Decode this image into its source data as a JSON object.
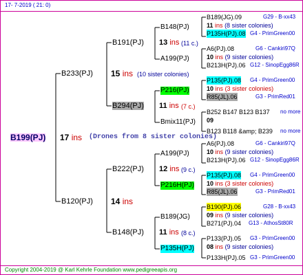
{
  "header": {
    "date": "17-  7-2019 (  21:  0)"
  },
  "footer": {
    "copyright": "Copyright 2004-2019 @ Karl Kehrle Foundation    www.pedigreeapis.org"
  },
  "tree": {
    "root": {
      "name": "B199(PJ)",
      "ins_count": "17",
      "ins_word": "ins",
      "note": "(Drones from 8 sister colonies)"
    },
    "gen1": [
      {
        "name": "B233(PJ)",
        "ins_count": "15",
        "ins_word": "ins",
        "note": "(10 sister colonies)"
      },
      {
        "name": "B120(PJ)",
        "ins_count": "14",
        "ins_word": "ins"
      }
    ],
    "gen2": [
      {
        "name": "B191(PJ)",
        "ins_count": "13",
        "ins_word": "ins",
        "note": "(11 c.)"
      },
      {
        "name": "B294(PJ)",
        "ins_count": "11",
        "ins_word": "ins",
        "note": "(7 c.)"
      },
      {
        "name": "B222(PJ)",
        "ins_count": "12",
        "ins_word": "ins",
        "note": "(9 c.)"
      },
      {
        "name": "B148(PJ)",
        "ins_count": "11",
        "ins_word": "ins",
        "note": "(8 c.)"
      }
    ],
    "gen3": [
      {
        "name": "B148(PJ)"
      },
      {
        "name": "A199(PJ)"
      },
      {
        "name": "P216(PJ)"
      },
      {
        "name": "Bmix11(PJ)"
      },
      {
        "name": "A199(PJ)"
      },
      {
        "name": "P216H(PJ)"
      },
      {
        "name": "B189(JG)"
      },
      {
        "name": "P135H(PJ)"
      }
    ],
    "gen4": [
      {
        "line1": "B189(JG).09",
        "code1": "G29 - B-xx43",
        "count": "11",
        "ins_word": "ins",
        "note": "(8 sister colonies)",
        "line3": "P135H(PJ).08",
        "code3": "G4 - PrimGreen00"
      },
      {
        "line1": "A6(PJ).08",
        "code1": "G6 - Cankiri97Q",
        "count": "10",
        "ins_word": "ins",
        "note": "(9 sister colonies)",
        "line3": "B213H(PJ).06",
        "code3": "G12 - SinopEgg86R"
      },
      {
        "line1": "P135(PJ).08",
        "code1": "G4 - PrimGreen00",
        "count": "10",
        "ins_word": "ins",
        "note": "(3 sister colonies)",
        "line3": "R85(JL).06",
        "code3": "G3 - PrimRed01"
      },
      {
        "line1": "B252 B147 B123 B137",
        "code1": "no more",
        "count": "09",
        "ins_word": "",
        "note": "",
        "line3": "B123 B118 &amp; B239",
        "code3": "no more"
      },
      {
        "line1": "A6(PJ).08",
        "code1": "G6 - Cankiri97Q",
        "count": "10",
        "ins_word": "ins",
        "note": "(9 sister colonies)",
        "line3": "B213H(PJ).06",
        "code3": "G12 - SinopEgg86R"
      },
      {
        "line1": "P135(PJ).08",
        "code1": "G4 - PrimGreen00",
        "count": "10",
        "ins_word": "ins",
        "note": "(3 sister colonies)",
        "line3": "R85(JL).06",
        "code3": "G3 - PrimRed01"
      },
      {
        "line1": "B190(PJ).06",
        "code1": "G28 - B-xx43",
        "count": "09",
        "ins_word": "ins",
        "note": "(9 sister colonies)",
        "line3": "B271(PJ).04",
        "code3": "G13 - AthosSt80R"
      },
      {
        "line1": "P133(PJ).05",
        "code1": "G3 - PrimGreen00",
        "count": "08",
        "ins_word": "ins",
        "note": "(9 sister colonies)",
        "line3": "P133H(PJ).05",
        "code3": "G3 - PrimGreen00"
      }
    ]
  }
}
